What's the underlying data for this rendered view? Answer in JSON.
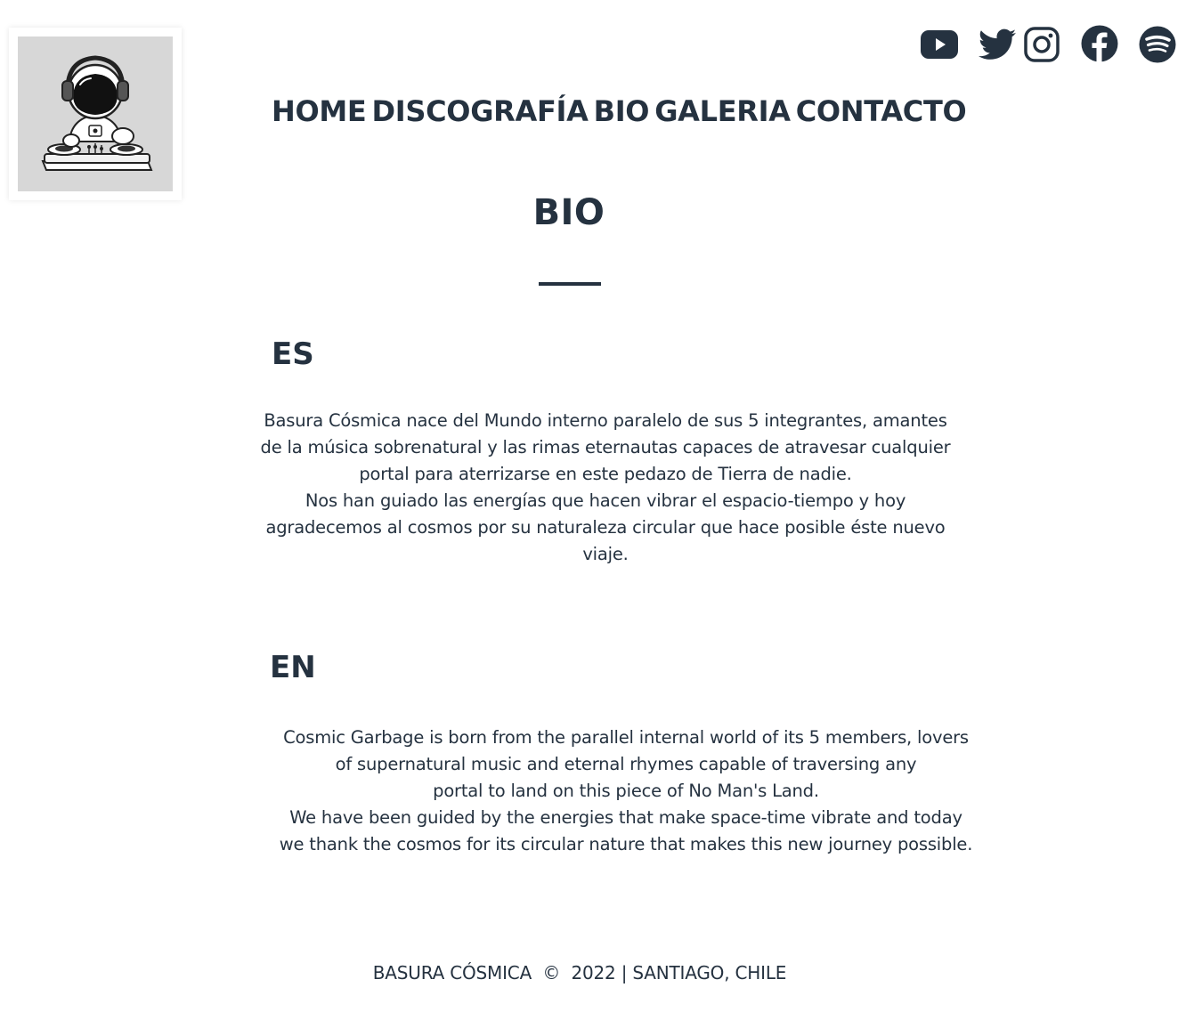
{
  "header": {
    "logo_alt": "astronaut DJ logo",
    "social": [
      {
        "name": "youtube-icon"
      },
      {
        "name": "twitter-icon"
      },
      {
        "name": "instagram-icon"
      },
      {
        "name": "facebook-icon"
      },
      {
        "name": "spotify-icon"
      }
    ]
  },
  "nav": {
    "items": [
      "HOME",
      "DISCOGRAFÍA",
      "BIO",
      "GALERIA",
      "CONTACTO"
    ]
  },
  "main": {
    "title": "BIO",
    "es": {
      "heading": "ES",
      "text": "Basura Cósmica nace del Mundo interno paralelo de sus 5 integrantes, amantes\nde la música sobrenatural y las rimas eternautas capaces de atravesar cualquier\nportal para aterrizarse en este pedazo de Tierra de nadie.\nNos han guiado las energías que hacen vibrar el espacio-tiempo y hoy\nagradecemos al cosmos por su naturaleza circular que hace posible éste nuevo\nviaje."
    },
    "en": {
      "heading": "EN",
      "text": "Cosmic Garbage is born from the parallel internal world of its 5 members, lovers\nof supernatural music and eternal rhymes capable of traversing any\nportal to land on this piece of No Man's Land.\nWe have been guided by the energies that make space-time vibrate and today\nwe thank the cosmos for its circular nature that makes this new journey possible."
    }
  },
  "footer": {
    "text": "BASURA CÓSMICA  ©  2022 | SANTIAGO, CHILE"
  },
  "colors": {
    "text": "#253240",
    "logo_bg": "#d7d7d7",
    "background": "#ffffff"
  }
}
